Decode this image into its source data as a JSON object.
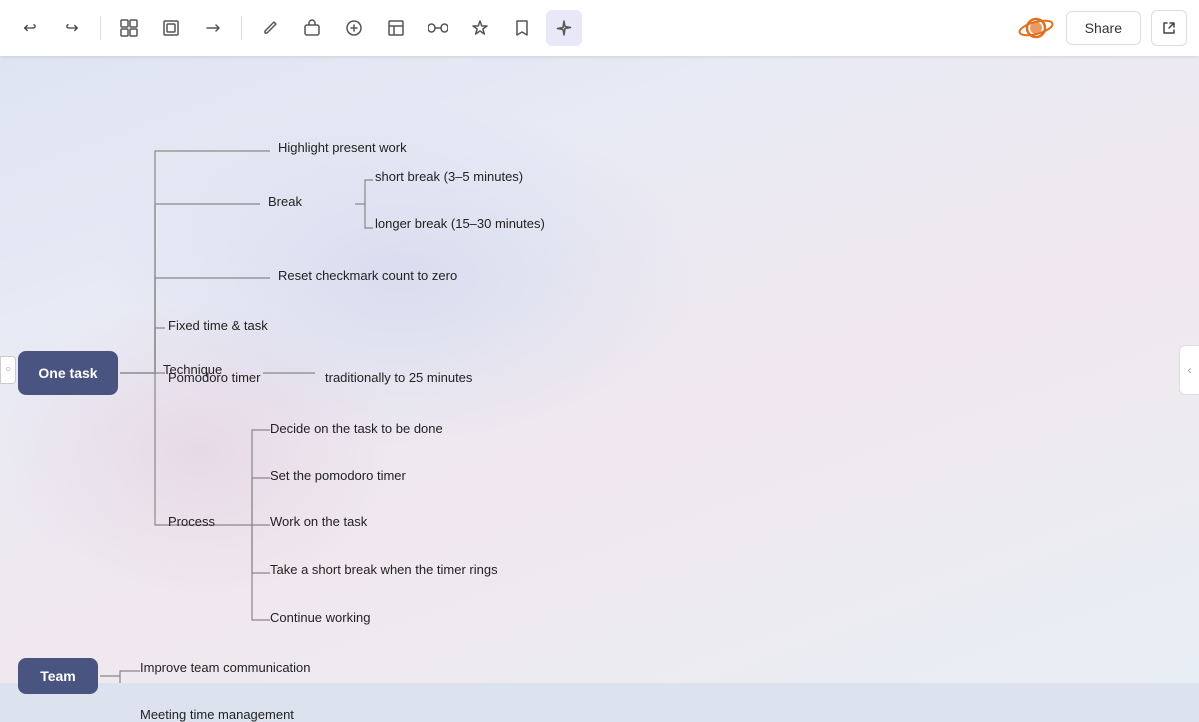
{
  "toolbar": {
    "buttons": [
      {
        "name": "undo",
        "icon": "↩"
      },
      {
        "name": "redo",
        "icon": "↪"
      },
      {
        "name": "group",
        "icon": "⊞"
      },
      {
        "name": "ungroup",
        "icon": "⊟"
      },
      {
        "name": "connect",
        "icon": "⟶"
      },
      {
        "name": "pen",
        "icon": "✏"
      },
      {
        "name": "shape",
        "icon": "⬜"
      },
      {
        "name": "plus",
        "icon": "+"
      },
      {
        "name": "table",
        "icon": "⊞"
      },
      {
        "name": "link",
        "icon": "∞"
      },
      {
        "name": "star",
        "icon": "✦"
      },
      {
        "name": "bookmark",
        "icon": "⊟"
      },
      {
        "name": "sparkle",
        "icon": "✧"
      }
    ],
    "share_label": "Share"
  },
  "nodes": {
    "one_task": "One task",
    "team": "Team",
    "technique": "Technique",
    "break": "Break",
    "short_break": "short break (3–5 minutes)",
    "longer_break": "longer break (15–30 minutes)",
    "highlight": "Highlight present work",
    "reset": "Reset checkmark count to zero",
    "fixed_time": "Fixed time & task",
    "pomodoro_timer": "Pomodoro timer",
    "traditionally": "traditionally to 25 minutes",
    "process": "Process",
    "decide": "Decide on the task to be done",
    "set_timer": "Set the pomodoro timer",
    "work_task": "Work on the task",
    "short_break2": "Take a short break when the timer rings",
    "continue": "Continue working",
    "improve": "Improve team communication",
    "meeting": "Meeting time management"
  }
}
